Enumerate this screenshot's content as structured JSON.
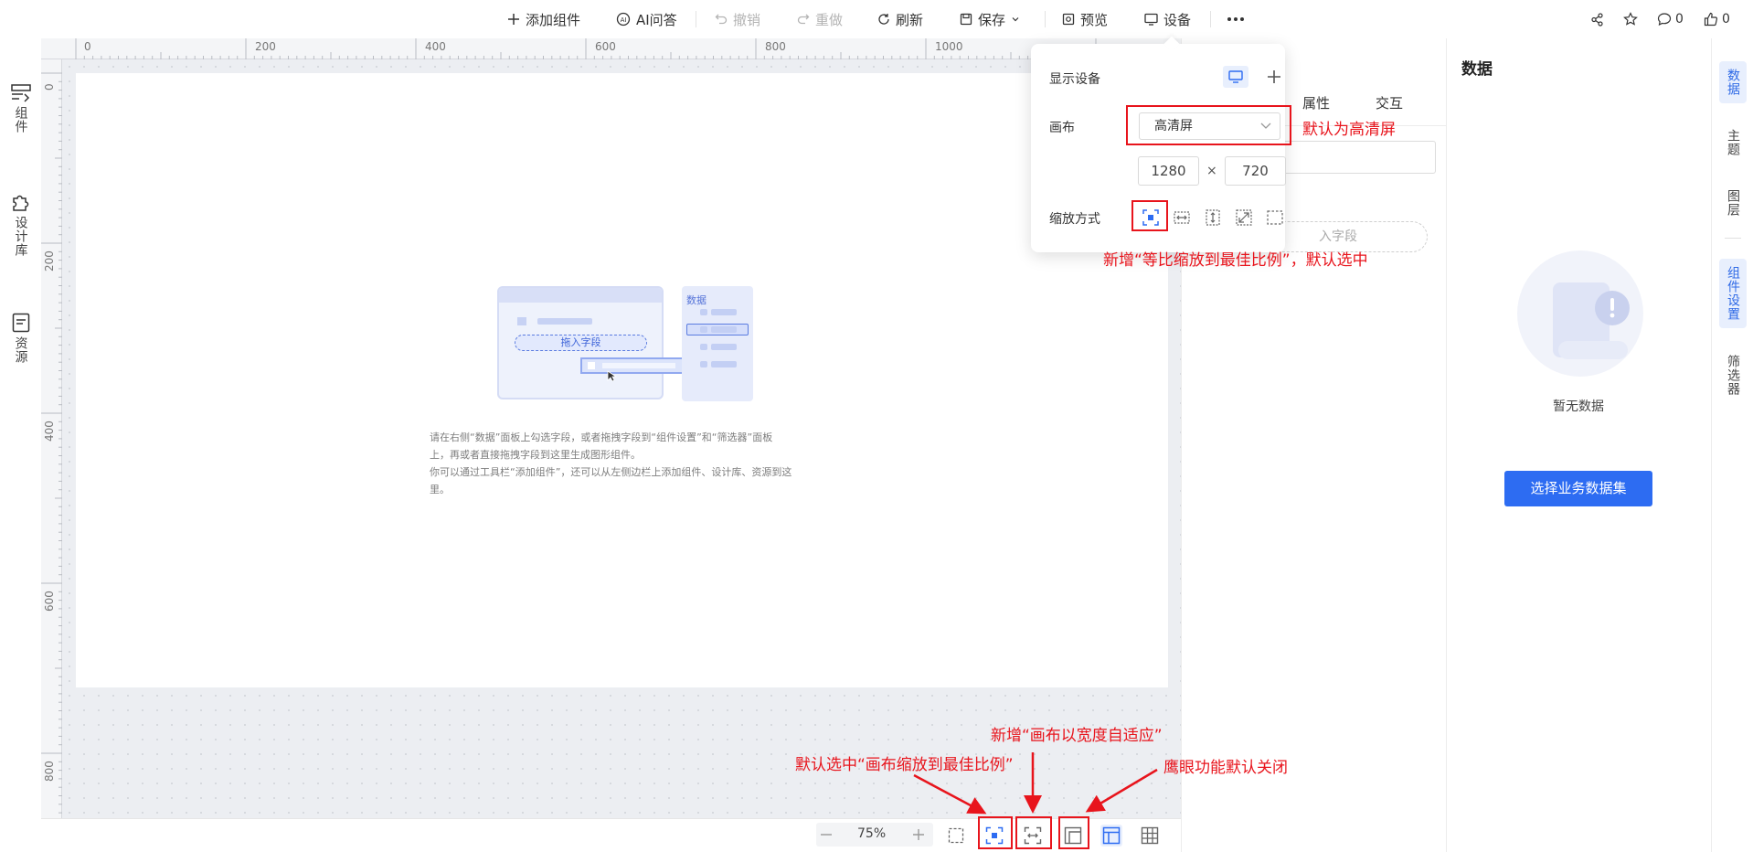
{
  "toolbar": {
    "add_component": "添加组件",
    "ai_qa": "AI问答",
    "undo": "撤销",
    "redo": "重做",
    "refresh": "刷新",
    "save": "保存",
    "preview": "预览",
    "device": "设备",
    "comments_count": "0",
    "likes_count": "0"
  },
  "left_nav": {
    "components": "组件",
    "design_library": "设计库",
    "resources": "资源"
  },
  "ruler": {
    "top": [
      "0",
      "200",
      "400",
      "600",
      "800",
      "1000"
    ],
    "left": [
      "0",
      "200",
      "400",
      "600",
      "800"
    ]
  },
  "canvas": {
    "illustration_data_title": "数据",
    "illustration_drop_label": "拖入字段",
    "hint_line1": "请在右侧“数据”面板上勾选字段，或者拖拽字段到“组件设置”和“筛选器”面板",
    "hint_line2": "上，再或者直接拖拽字段到这里生成图形组件。",
    "hint_line3": "你可以通过工具栏“添加组件”，还可以从左侧边栏上添加组件、设计库、资源到这",
    "hint_line4": "里。"
  },
  "device_popover": {
    "display_device_label": "显示设备",
    "canvas_label": "画布",
    "canvas_value": "高清屏",
    "width": "1280",
    "times": "×",
    "height": "720",
    "scale_mode_label": "缩放方式"
  },
  "annotations": {
    "default_hd": "默认为高清屏",
    "new_fit_scale": "新增“等比缩放到最佳比例”，默认选中",
    "new_width_fit": "新增“画布以宽度自适应”",
    "default_best_scale": "默认选中“画布缩放到最佳比例”",
    "minimap_off": "鹰眼功能默认关闭",
    "red_color": "#e8141c"
  },
  "prop_panel": {
    "tab_properties_partial": "属性",
    "tab_interaction": "交互",
    "drop_field_partial": "入字段"
  },
  "data_panel": {
    "title": "数据",
    "empty_text": "暂无数据",
    "select_dataset_button": "选择业务数据集",
    "accent_color": "#2d6cf2"
  },
  "right_tabs": {
    "data": "数据",
    "theme": "主题",
    "layers": "图层",
    "component_settings": "组件设置",
    "filters": "筛选器"
  },
  "bottom_bar": {
    "zoom": "75%"
  }
}
